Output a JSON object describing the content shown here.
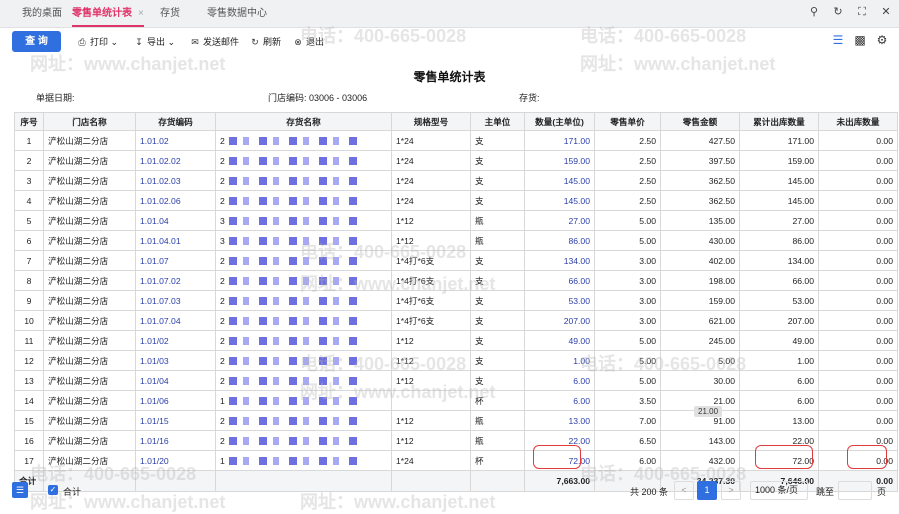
{
  "tabs": [
    {
      "label": "我的桌面"
    },
    {
      "label": "零售单统计表"
    },
    {
      "label": "存货"
    },
    {
      "label": "零售数据中心"
    }
  ],
  "tab_close": "×",
  "toolbar": {
    "query": "查 询",
    "print": "打印",
    "export": "导出",
    "email": "发送邮件",
    "refresh": "刷新",
    "exit": "退出"
  },
  "report": {
    "title": "零售单统计表",
    "date_label": "单据日期:",
    "store_label": "门店编码:",
    "store_value": "03006 - 03006",
    "stock_label": "存货:"
  },
  "columns": [
    "序号",
    "门店名称",
    "存货编码",
    "存货名称",
    "规格型号",
    "主单位",
    "数量(主单位)",
    "零售单价",
    "零售金额",
    "累计出库数量",
    "未出库数量"
  ],
  "rows": [
    {
      "no": "1",
      "store": "浐松山湖二分店",
      "code": "1.01.02",
      "name": "2",
      "spec": "1*24",
      "unit": "支",
      "qty": "171.00",
      "price": "2.50",
      "amount": "427.50",
      "out": "171.00",
      "notout": "0.00"
    },
    {
      "no": "2",
      "store": "浐松山湖二分店",
      "code": "1.01.02.02",
      "name": "2",
      "spec": "1*24",
      "unit": "支",
      "qty": "159.00",
      "price": "2.50",
      "amount": "397.50",
      "out": "159.00",
      "notout": "0.00"
    },
    {
      "no": "3",
      "store": "浐松山湖二分店",
      "code": "1.01.02.03",
      "name": "2",
      "spec": "1*24",
      "unit": "支",
      "qty": "145.00",
      "price": "2.50",
      "amount": "362.50",
      "out": "145.00",
      "notout": "0.00"
    },
    {
      "no": "4",
      "store": "浐松山湖二分店",
      "code": "1.01.02.06",
      "name": "2",
      "spec": "1*24",
      "unit": "支",
      "qty": "145.00",
      "price": "2.50",
      "amount": "362.50",
      "out": "145.00",
      "notout": "0.00"
    },
    {
      "no": "5",
      "store": "浐松山湖二分店",
      "code": "1.01.04",
      "name": "3",
      "spec": "1*12",
      "unit": "瓶",
      "qty": "27.00",
      "price": "5.00",
      "amount": "135.00",
      "out": "27.00",
      "notout": "0.00"
    },
    {
      "no": "6",
      "store": "浐松山湖二分店",
      "code": "1.01.04.01",
      "name": "3",
      "spec": "1*12",
      "unit": "瓶",
      "qty": "86.00",
      "price": "5.00",
      "amount": "430.00",
      "out": "86.00",
      "notout": "0.00"
    },
    {
      "no": "7",
      "store": "浐松山湖二分店",
      "code": "1.01.07",
      "name": "2",
      "spec": "1*4打*6支",
      "unit": "支",
      "qty": "134.00",
      "price": "3.00",
      "amount": "402.00",
      "out": "134.00",
      "notout": "0.00"
    },
    {
      "no": "8",
      "store": "浐松山湖二分店",
      "code": "1.01.07.02",
      "name": "2",
      "spec": "1*4打*6支",
      "unit": "支",
      "qty": "66.00",
      "price": "3.00",
      "amount": "198.00",
      "out": "66.00",
      "notout": "0.00"
    },
    {
      "no": "9",
      "store": "浐松山湖二分店",
      "code": "1.01.07.03",
      "name": "2",
      "spec": "1*4打*6支",
      "unit": "支",
      "qty": "53.00",
      "price": "3.00",
      "amount": "159.00",
      "out": "53.00",
      "notout": "0.00"
    },
    {
      "no": "10",
      "store": "浐松山湖二分店",
      "code": "1.01.07.04",
      "name": "2",
      "spec": "1*4打*6支",
      "unit": "支",
      "qty": "207.00",
      "price": "3.00",
      "amount": "621.00",
      "out": "207.00",
      "notout": "0.00"
    },
    {
      "no": "11",
      "store": "浐松山湖二分店",
      "code": "1.01/02",
      "name": "2",
      "spec": "1*12",
      "unit": "支",
      "qty": "49.00",
      "price": "5.00",
      "amount": "245.00",
      "out": "49.00",
      "notout": "0.00"
    },
    {
      "no": "12",
      "store": "浐松山湖二分店",
      "code": "1.01/03",
      "name": "2",
      "spec": "1*12",
      "unit": "支",
      "qty": "1.00",
      "price": "5.00",
      "amount": "5.00",
      "out": "1.00",
      "notout": "0.00"
    },
    {
      "no": "13",
      "store": "浐松山湖二分店",
      "code": "1.01/04",
      "name": "2",
      "spec": "1*12",
      "unit": "支",
      "qty": "6.00",
      "price": "5.00",
      "amount": "30.00",
      "out": "6.00",
      "notout": "0.00"
    },
    {
      "no": "14",
      "store": "浐松山湖二分店",
      "code": "1.01/06",
      "name": "1",
      "spec": "",
      "unit": "杯",
      "qty": "6.00",
      "price": "3.50",
      "amount": "21.00",
      "out": "6.00",
      "notout": "0.00"
    },
    {
      "no": "15",
      "store": "浐松山湖二分店",
      "code": "1.01/15",
      "name": "2",
      "spec": "1*12",
      "unit": "瓶",
      "qty": "13.00",
      "price": "7.00",
      "amount": "91.00",
      "out": "13.00",
      "notout": "0.00"
    },
    {
      "no": "16",
      "store": "浐松山湖二分店",
      "code": "1.01/16",
      "name": "2",
      "spec": "1*12",
      "unit": "瓶",
      "qty": "22.00",
      "price": "6.50",
      "amount": "143.00",
      "out": "22.00",
      "notout": "0.00"
    },
    {
      "no": "17",
      "store": "浐松山湖二分店",
      "code": "1.01/20",
      "name": "1",
      "spec": "1*24",
      "unit": "杯",
      "qty": "72.00",
      "price": "6.00",
      "amount": "432.00",
      "out": "72.00",
      "notout": "0.00"
    }
  ],
  "total": {
    "label": "合计",
    "qty": "7,663.00",
    "amount": "34,237.30",
    "out": "7,646.00",
    "notout": "0.00"
  },
  "tooltip": "21.00",
  "footer": {
    "checkbox_label": "合计",
    "total_count": "共 200 条",
    "current_page": "1",
    "page_size": "1000 条/页",
    "jump": "跳至",
    "page_suffix": "页"
  },
  "watermark": {
    "phone": "电话：400-665-0028",
    "site": "网址：www.chanjet.net"
  },
  "colors": {
    "accent": "#2f6fe0",
    "active_tab": "#e0356b",
    "highlight": "#e23b3b",
    "link": "#2b3fa8"
  }
}
